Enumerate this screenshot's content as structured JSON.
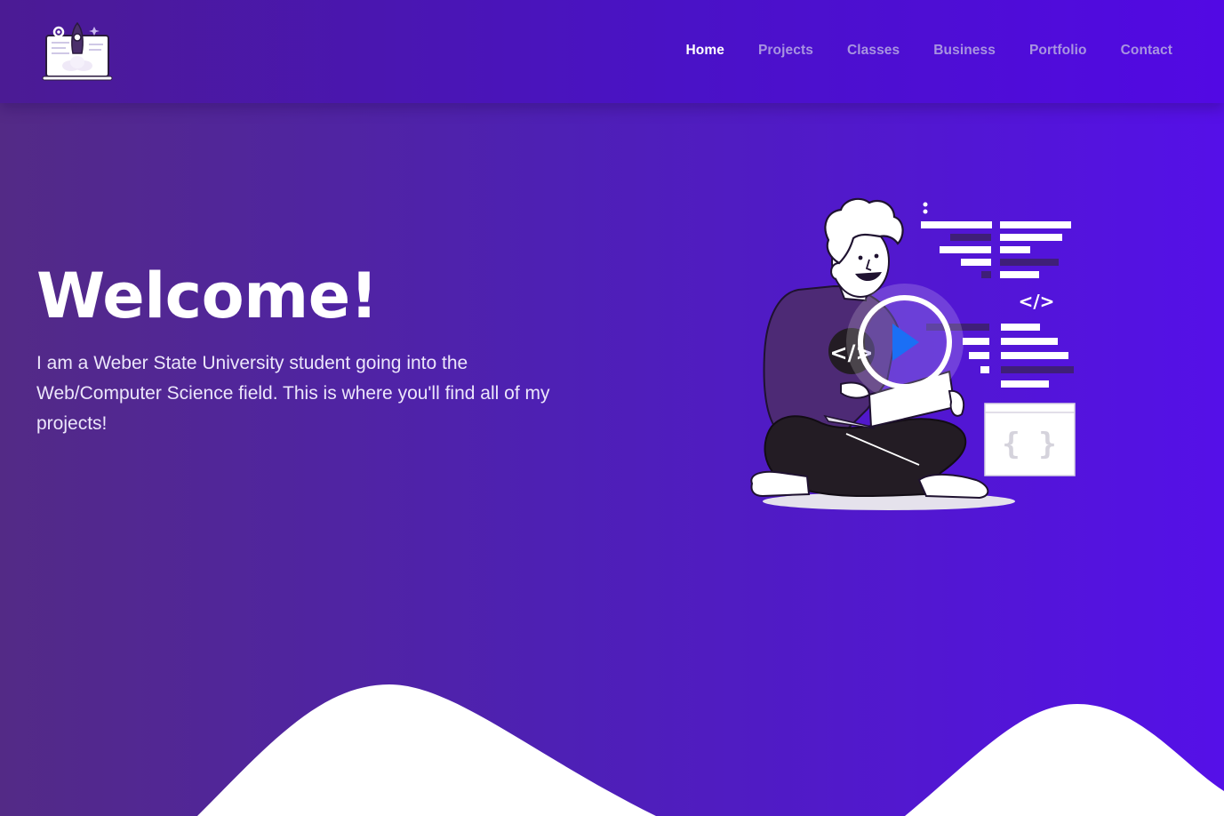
{
  "nav": {
    "logo_icon": "rocket-laptop-icon",
    "links": [
      {
        "label": "Home",
        "active": true
      },
      {
        "label": "Projects",
        "active": false
      },
      {
        "label": "Classes",
        "active": false
      },
      {
        "label": "Business",
        "active": false
      },
      {
        "label": "Portfolio",
        "active": false
      },
      {
        "label": "Contact",
        "active": false
      }
    ]
  },
  "hero": {
    "title": "Welcome!",
    "description": "I am a Weber State University student going into the Web/Computer Science field. This is where you'll find all of my projects!",
    "illustration": {
      "icon": "developer-with-laptop-illustration",
      "code_tag_label": "</>",
      "braces_label": "{  }",
      "play_icon": "play-icon"
    }
  },
  "colors": {
    "background_left": "#532a86",
    "background_right": "#5510e8",
    "accent_play": "#1b6ff5",
    "nav_active": "#ffffff",
    "nav_inactive": "#a894e0"
  }
}
